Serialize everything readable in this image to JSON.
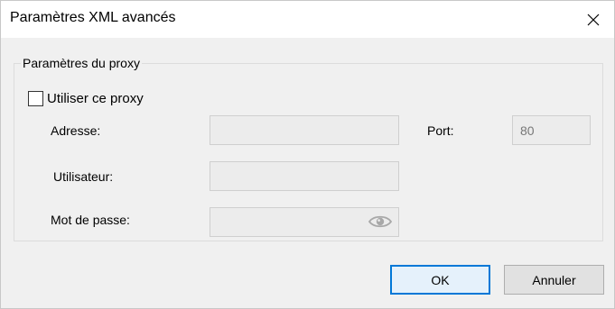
{
  "window": {
    "title": "Paramètres XML avancés"
  },
  "proxy_group": {
    "legend": "Paramètres du proxy",
    "use_proxy_label": "Utiliser ce proxy",
    "use_proxy_checked": false,
    "address_label": "Adresse:",
    "address_value": "",
    "port_label": "Port:",
    "port_value": "80",
    "user_label": "Utilisateur:",
    "user_value": "",
    "password_label": "Mot de passe:",
    "password_value": ""
  },
  "buttons": {
    "ok_label": "OK",
    "cancel_label": "Annuler"
  },
  "colors": {
    "accent": "#0078d7",
    "background": "#f0f0f0",
    "titlebar": "#ffffff"
  }
}
